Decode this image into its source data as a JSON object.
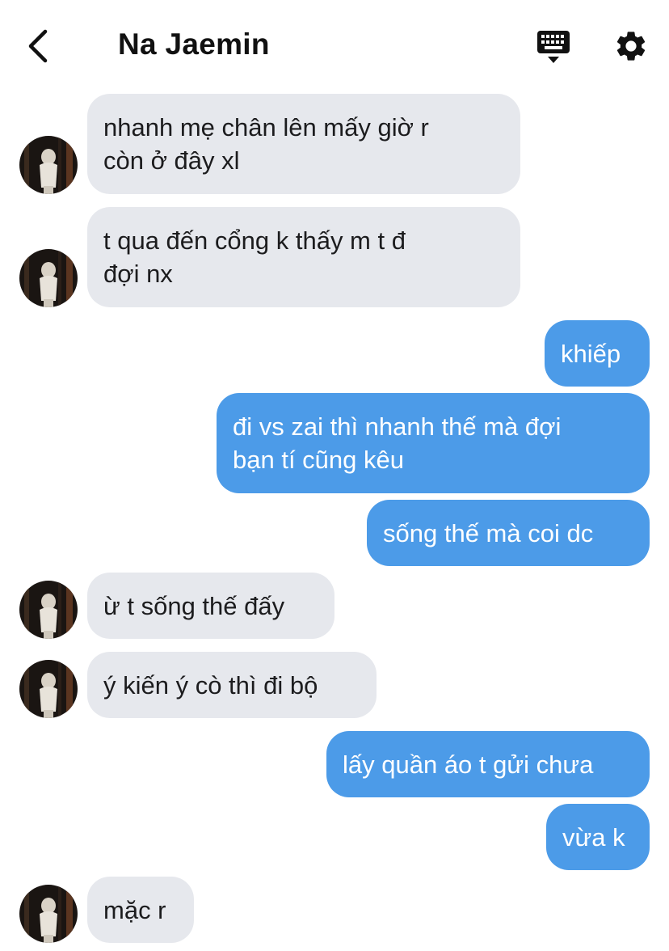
{
  "header": {
    "title": "Na Jaemin",
    "back_icon": "chevron-left-icon",
    "keyboard_icon": "keyboard-icon",
    "settings_icon": "gear-icon"
  },
  "colors": {
    "incoming_bubble": "#e6e8ed",
    "outgoing_bubble": "#4c9be8",
    "background": "#ffffff"
  },
  "messages": [
    {
      "direction": "incoming",
      "lines": [
        "nhanh mẹ chân lên mấy giờ r",
        "còn ở đây xl"
      ]
    },
    {
      "direction": "incoming",
      "lines": [
        "t qua đến cổng k thấy m t đ",
        "đợi nx"
      ]
    },
    {
      "direction": "outgoing",
      "lines": [
        "khiếp"
      ]
    },
    {
      "direction": "outgoing",
      "lines": [
        "đi vs zai thì nhanh thế mà đợi",
        "bạn tí cũng kêu"
      ]
    },
    {
      "direction": "outgoing",
      "lines": [
        "sống thế mà coi dc"
      ]
    },
    {
      "direction": "incoming",
      "lines": [
        "ừ t sống thế đấy"
      ]
    },
    {
      "direction": "incoming",
      "lines": [
        "ý kiến ý cò thì đi bộ"
      ]
    },
    {
      "direction": "outgoing",
      "lines": [
        "lấy quần áo t gửi chưa"
      ]
    },
    {
      "direction": "outgoing",
      "lines": [
        "vừa k"
      ]
    },
    {
      "direction": "incoming",
      "lines": [
        "mặc r"
      ]
    }
  ]
}
